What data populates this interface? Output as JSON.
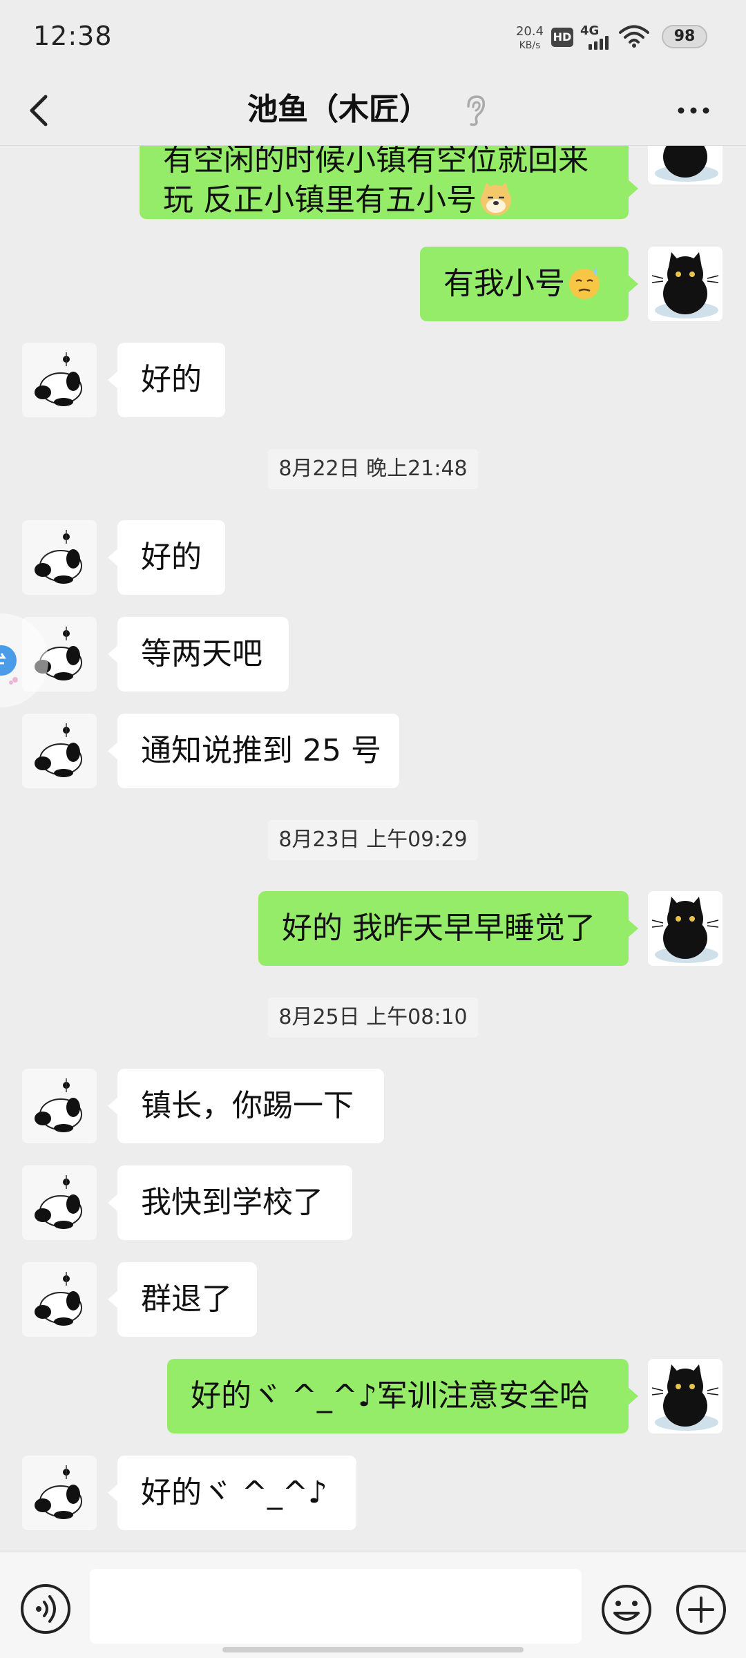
{
  "status_bar": {
    "time": "12:38",
    "net_speed_value": "20.4",
    "net_speed_unit": "KB/s",
    "hd_badge": "HD",
    "network_type": "4G",
    "battery": "98",
    "icons": [
      "hd-icon",
      "signal-icon",
      "wifi-icon",
      "battery-icon"
    ]
  },
  "header": {
    "title": "池鱼（木匠）",
    "icons": [
      "back-icon",
      "ear-icon",
      "more-icon"
    ]
  },
  "messages": [
    {
      "side": "out",
      "text_line1": "有空闲的时候小镇有空位就回来",
      "text_line2": "玩 反正小镇里有五小号",
      "emoji": "doge-emoji"
    },
    {
      "side": "out",
      "text": "有我小号",
      "emoji": "sweat-emoji"
    },
    {
      "side": "in",
      "text": "好的"
    },
    {
      "type": "time",
      "text": "8月22日 晚上21:48"
    },
    {
      "side": "in",
      "text": "好的"
    },
    {
      "side": "in",
      "text": "等两天吧"
    },
    {
      "side": "in",
      "text": "通知说推到 25 号"
    },
    {
      "type": "time",
      "text": "8月23日 上午09:29"
    },
    {
      "side": "out",
      "text": "好的 我昨天早早睡觉了"
    },
    {
      "type": "time",
      "text": "8月25日 上午08:10"
    },
    {
      "side": "in",
      "text": "镇长，你踢一下"
    },
    {
      "side": "in",
      "text": "我快到学校了"
    },
    {
      "side": "in",
      "text": "群退了"
    },
    {
      "side": "out",
      "text": "好的ヾ ^_^♪军训注意安全哈"
    },
    {
      "side": "in",
      "text": "好的ヾ ^_^♪"
    }
  ],
  "input": {
    "value": "",
    "icons": [
      "voice-icon",
      "emoji-icon",
      "plus-icon"
    ]
  },
  "colors": {
    "background": "#ededed",
    "outgoing_bubble": "#95ec69",
    "incoming_bubble": "#ffffff",
    "input_bar": "#f6f6f6"
  }
}
